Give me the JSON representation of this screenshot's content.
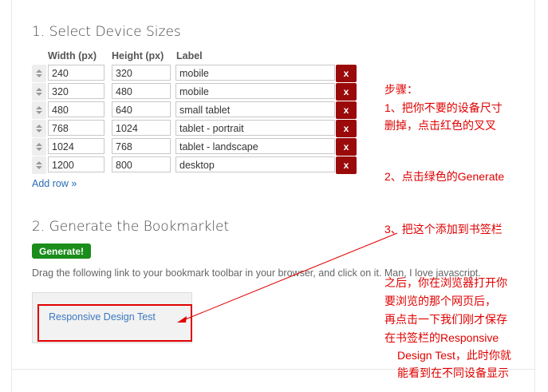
{
  "section1": {
    "title": "1. Select Device Sizes",
    "headers": {
      "width": "Width (px)",
      "height": "Height (px)",
      "label": "Label"
    },
    "rows": [
      {
        "width": "240",
        "height": "320",
        "label": "mobile",
        "delete": "x"
      },
      {
        "width": "320",
        "height": "480",
        "label": "mobile",
        "delete": "x"
      },
      {
        "width": "480",
        "height": "640",
        "label": "small tablet",
        "delete": "x"
      },
      {
        "width": "768",
        "height": "1024",
        "label": "tablet - portrait",
        "delete": "x"
      },
      {
        "width": "1024",
        "height": "768",
        "label": "tablet - landscape",
        "delete": "x"
      },
      {
        "width": "1200",
        "height": "800",
        "label": "desktop",
        "delete": "x"
      }
    ],
    "add_row": "Add row »"
  },
  "section2": {
    "title": "2. Generate the Bookmarklet",
    "generate_button": "Generate!",
    "instructions": "Drag the following link to your bookmark toolbar in your browser, and click on it. Man, I love javascript.",
    "bookmarklet_link": "Responsive Design Test"
  },
  "annotations": {
    "steps": "步骤：",
    "step1_line1": "1、把你不要的设备尺寸",
    "step1_line2": "删掉，点击红色的叉叉",
    "step2": "2、点击绿色的Generate",
    "step3": "3、把这个添加到书签栏",
    "after_line1": "之后，你在浏览器打开你",
    "after_line2": "要浏览的那个网页后，",
    "after_line3": "再点击一下我们刚才保存",
    "after_line4": "在书签栏的Responsive",
    "after_line5": "Design Test，此时你就",
    "after_line6": "能看到在不同设备显示"
  },
  "colors": {
    "delete_button": "#9b0a0a",
    "generate_button": "#1a8d1a",
    "link": "#3b78c2",
    "annotation": "#e00000"
  }
}
